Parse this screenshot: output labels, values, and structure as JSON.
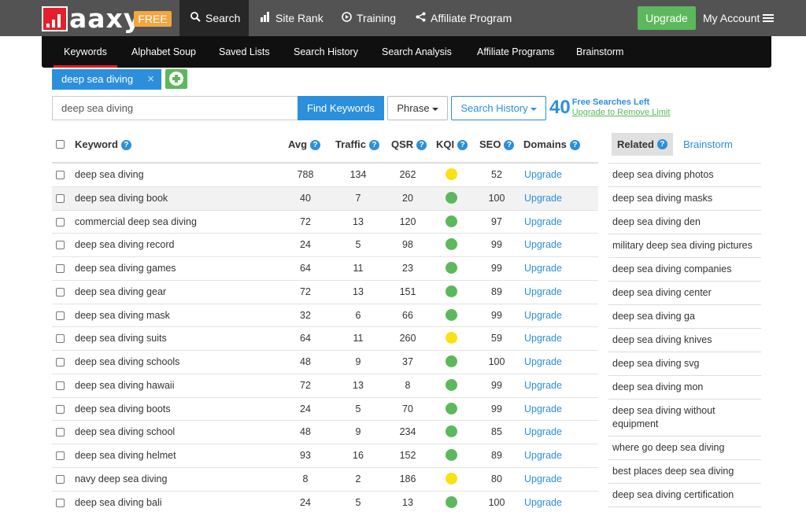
{
  "app": {
    "logo_text": "aaxy",
    "badge": "FREE"
  },
  "nav": {
    "items": [
      {
        "label": "Search",
        "icon": "search-icon"
      },
      {
        "label": "Site Rank",
        "icon": "bar-chart-icon"
      },
      {
        "label": "Training",
        "icon": "play-circle-icon"
      },
      {
        "label": "Affiliate Program",
        "icon": "share-icon"
      }
    ],
    "upgrade": "Upgrade",
    "account": "My Account"
  },
  "subnav": {
    "items": [
      "Keywords",
      "Alphabet Soup",
      "Saved Lists",
      "Search History",
      "Search Analysis",
      "Affiliate Programs",
      "Brainstorm"
    ]
  },
  "tag": {
    "label": "deep sea diving",
    "close": "×"
  },
  "search": {
    "value": "deep sea diving",
    "find_label": "Find Keywords",
    "phrase_label": "Phrase",
    "history_label": "Search History",
    "searches_count": "40",
    "searches_label": "Free Searches Left",
    "upgrade_link": "Upgrade to Remove Limit"
  },
  "table": {
    "headers": {
      "keyword": "Keyword",
      "avg": "Avg",
      "traffic": "Traffic",
      "qsr": "QSR",
      "kqi": "KQI",
      "seo": "SEO",
      "domains": "Domains"
    },
    "rows": [
      {
        "keyword": "deep sea diving",
        "avg": "788",
        "traffic": "134",
        "qsr": "262",
        "kqi": "yellow",
        "seo": "52",
        "domains": "Upgrade"
      },
      {
        "keyword": "deep sea diving book",
        "avg": "40",
        "traffic": "7",
        "qsr": "20",
        "kqi": "green",
        "seo": "100",
        "domains": "Upgrade"
      },
      {
        "keyword": "commercial deep sea diving",
        "avg": "72",
        "traffic": "13",
        "qsr": "120",
        "kqi": "green",
        "seo": "97",
        "domains": "Upgrade"
      },
      {
        "keyword": "deep sea diving record",
        "avg": "24",
        "traffic": "5",
        "qsr": "98",
        "kqi": "green",
        "seo": "99",
        "domains": "Upgrade"
      },
      {
        "keyword": "deep sea diving games",
        "avg": "64",
        "traffic": "11",
        "qsr": "23",
        "kqi": "green",
        "seo": "99",
        "domains": "Upgrade"
      },
      {
        "keyword": "deep sea diving gear",
        "avg": "72",
        "traffic": "13",
        "qsr": "151",
        "kqi": "green",
        "seo": "89",
        "domains": "Upgrade"
      },
      {
        "keyword": "deep sea diving mask",
        "avg": "32",
        "traffic": "6",
        "qsr": "66",
        "kqi": "green",
        "seo": "99",
        "domains": "Upgrade"
      },
      {
        "keyword": "deep sea diving suits",
        "avg": "64",
        "traffic": "11",
        "qsr": "260",
        "kqi": "yellow",
        "seo": "59",
        "domains": "Upgrade"
      },
      {
        "keyword": "deep sea diving schools",
        "avg": "48",
        "traffic": "9",
        "qsr": "37",
        "kqi": "green",
        "seo": "100",
        "domains": "Upgrade"
      },
      {
        "keyword": "deep sea diving hawaii",
        "avg": "72",
        "traffic": "13",
        "qsr": "8",
        "kqi": "green",
        "seo": "99",
        "domains": "Upgrade"
      },
      {
        "keyword": "deep sea diving boots",
        "avg": "24",
        "traffic": "5",
        "qsr": "70",
        "kqi": "green",
        "seo": "99",
        "domains": "Upgrade"
      },
      {
        "keyword": "deep sea diving school",
        "avg": "48",
        "traffic": "9",
        "qsr": "234",
        "kqi": "green",
        "seo": "85",
        "domains": "Upgrade"
      },
      {
        "keyword": "deep sea diving helmet",
        "avg": "93",
        "traffic": "16",
        "qsr": "152",
        "kqi": "green",
        "seo": "89",
        "domains": "Upgrade"
      },
      {
        "keyword": "navy deep sea diving",
        "avg": "8",
        "traffic": "2",
        "qsr": "186",
        "kqi": "yellow",
        "seo": "80",
        "domains": "Upgrade"
      },
      {
        "keyword": "deep sea diving bali",
        "avg": "24",
        "traffic": "5",
        "qsr": "13",
        "kqi": "green",
        "seo": "100",
        "domains": "Upgrade"
      }
    ]
  },
  "side": {
    "related_tab": "Related",
    "brainstorm_tab": "Brainstorm",
    "items": [
      "deep sea diving photos",
      "deep sea diving masks",
      "deep sea diving den",
      "military deep sea diving pictures",
      "deep sea diving companies",
      "deep sea diving center",
      "deep sea diving ga",
      "deep sea diving knives",
      "deep sea diving svg",
      "deep sea diving mon",
      "deep sea diving without equipment",
      "where go deep sea diving",
      "best places deep sea diving",
      "deep sea diving certification"
    ]
  },
  "colors": {
    "accent_blue": "#2b8fdb",
    "green": "#5cb85c",
    "kqi_green": "#5cb85c",
    "kqi_yellow": "#f7e315",
    "brand_red": "#e3202b",
    "badge_orange": "#f3a640"
  }
}
